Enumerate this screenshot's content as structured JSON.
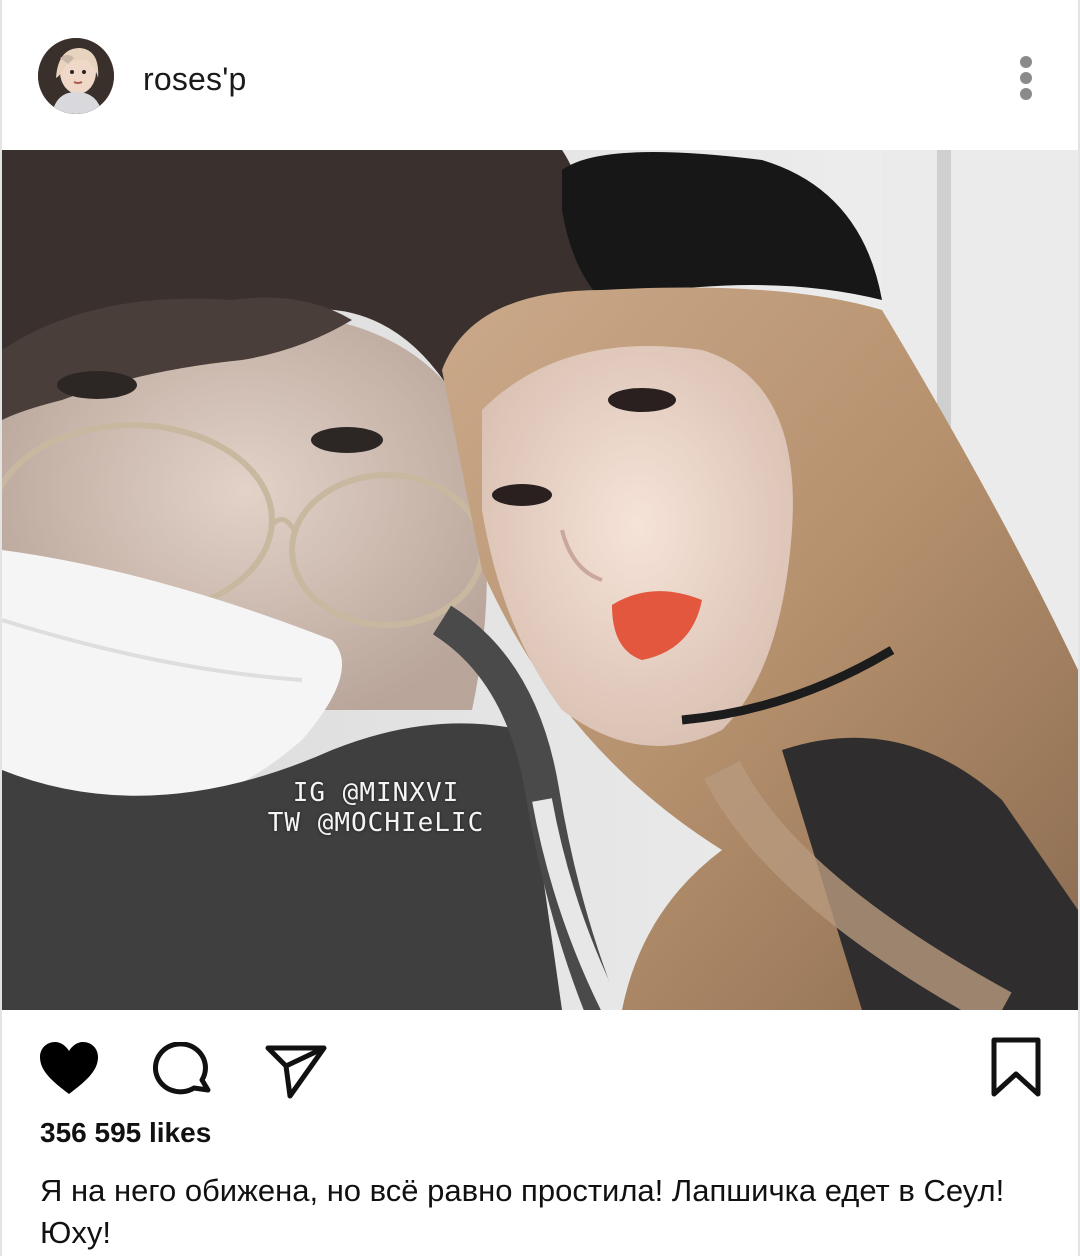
{
  "post": {
    "username": "roses'p",
    "likes_text": "356 595 likes",
    "caption": "Я на него обижена, но всё равно простила! Лапшичка едет в Сеул! Юху!"
  },
  "photo": {
    "watermark_line1": "IG @MINXVI",
    "watermark_line2": "TW @MOCHIeLIC"
  },
  "icons": {
    "like": "heart-icon",
    "comment": "comment-icon",
    "share": "send-icon",
    "save": "bookmark-icon",
    "more": "more-vertical-icon"
  },
  "colors": {
    "heart": "#000000",
    "icon_stroke": "#111111",
    "more_dots": "#8a8a8a"
  }
}
